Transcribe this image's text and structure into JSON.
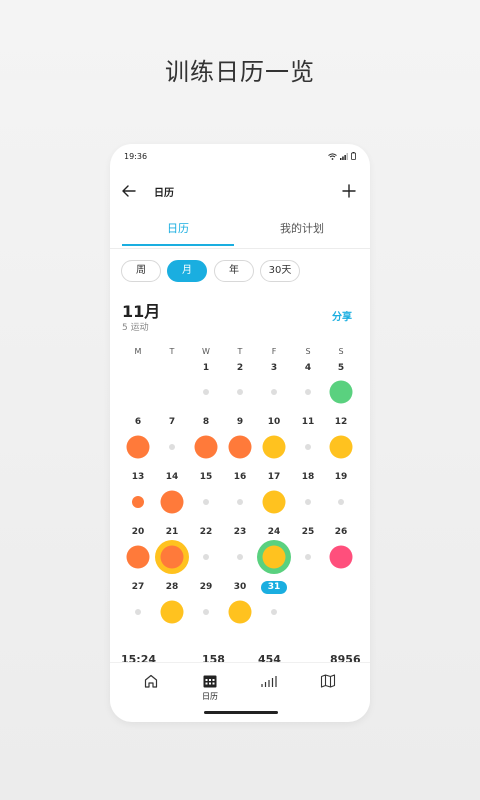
{
  "headline": "训练日历一览",
  "status": {
    "time": "19:36"
  },
  "appbar": {
    "title": "日历"
  },
  "tabs": [
    {
      "label": "日历",
      "active": true
    },
    {
      "label": "我的计划",
      "active": false
    }
  ],
  "filters": [
    {
      "label": "周",
      "active": false
    },
    {
      "label": "月",
      "active": true
    },
    {
      "label": "年",
      "active": false
    },
    {
      "label": "30天",
      "active": false
    }
  ],
  "calendar": {
    "month": "11月",
    "count_label": "5 运动",
    "share_label": "分享",
    "weekdays": [
      "M",
      "T",
      "W",
      "T",
      "F",
      "S",
      "S"
    ],
    "colors": {
      "orange": "#ff7a3a",
      "yellow": "#ffc21f",
      "green": "#5ad17f",
      "pink": "#ff4f7c",
      "empty": "#dedede",
      "accent": "#1aaee0"
    },
    "weeks": [
      [
        null,
        null,
        {
          "day": "1",
          "mark": "empty"
        },
        {
          "day": "2",
          "mark": "empty"
        },
        {
          "day": "3",
          "mark": "empty"
        },
        {
          "day": "4",
          "mark": "empty"
        },
        {
          "day": "5",
          "mark": "green"
        }
      ],
      [
        {
          "day": "6",
          "mark": "orange"
        },
        {
          "day": "7",
          "mark": "empty"
        },
        {
          "day": "8",
          "mark": "orange"
        },
        {
          "day": "9",
          "mark": "orange"
        },
        {
          "day": "10",
          "mark": "yellow"
        },
        {
          "day": "11",
          "mark": "empty"
        },
        {
          "day": "12",
          "mark": "yellow"
        }
      ],
      [
        {
          "day": "13",
          "mark": "orange-small"
        },
        {
          "day": "14",
          "mark": "orange"
        },
        {
          "day": "15",
          "mark": "empty"
        },
        {
          "day": "16",
          "mark": "empty"
        },
        {
          "day": "17",
          "mark": "yellow"
        },
        {
          "day": "18",
          "mark": "empty"
        },
        {
          "day": "19",
          "mark": "empty"
        }
      ],
      [
        {
          "day": "20",
          "mark": "orange"
        },
        {
          "day": "21",
          "mark": "yellow-orange"
        },
        {
          "day": "22",
          "mark": "empty"
        },
        {
          "day": "23",
          "mark": "empty"
        },
        {
          "day": "24",
          "mark": "green-yellow"
        },
        {
          "day": "25",
          "mark": "empty"
        },
        {
          "day": "26",
          "mark": "pink"
        }
      ],
      [
        {
          "day": "27",
          "mark": "empty"
        },
        {
          "day": "28",
          "mark": "yellow"
        },
        {
          "day": "29",
          "mark": "empty"
        },
        {
          "day": "30",
          "mark": "yellow"
        },
        {
          "day": "31",
          "mark": "empty",
          "today": true
        },
        null,
        null
      ]
    ]
  },
  "stats_row": [
    "15:24",
    "158",
    "454",
    "8956"
  ],
  "bottom_nav": [
    {
      "icon": "home-icon",
      "label": ""
    },
    {
      "icon": "calendar-icon",
      "label": "日历"
    },
    {
      "icon": "bar-chart-icon",
      "label": ""
    },
    {
      "icon": "map-icon",
      "label": ""
    }
  ]
}
